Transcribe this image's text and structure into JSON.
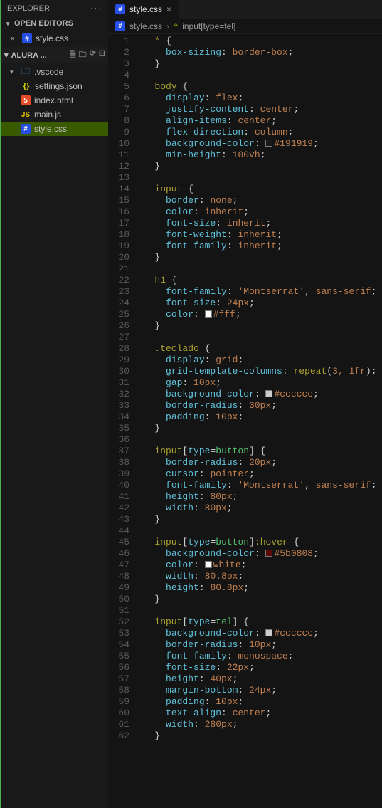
{
  "sidebar": {
    "header": "EXPLORER",
    "openEditorsTitle": "OPEN EDITORS",
    "openEditors": [
      {
        "name": "style.css"
      }
    ],
    "folderName": "ALURA ...",
    "tree": {
      "vscode": ".vscode",
      "settings": "settings.json",
      "index": "index.html",
      "main": "main.js",
      "style": "style.css"
    }
  },
  "tab": {
    "name": "style.css"
  },
  "breadcrumb": {
    "file": "style.css",
    "symbol": "input[type=tel]"
  },
  "code": {
    "lines": [
      {
        "n": 1,
        "t": "sel-open",
        "a": "*",
        "b": " {"
      },
      {
        "n": 2,
        "t": "prop",
        "p": "box-sizing",
        "v": "border-box"
      },
      {
        "n": 3,
        "t": "close"
      },
      {
        "n": 4,
        "t": "blank"
      },
      {
        "n": 5,
        "t": "sel-open",
        "a": "body",
        "b": " {"
      },
      {
        "n": 6,
        "t": "prop",
        "p": "display",
        "v": "flex"
      },
      {
        "n": 7,
        "t": "prop",
        "p": "justify-content",
        "v": "center"
      },
      {
        "n": 8,
        "t": "prop",
        "p": "align-items",
        "v": "center"
      },
      {
        "n": 9,
        "t": "prop",
        "p": "flex-direction",
        "v": "column"
      },
      {
        "n": 10,
        "t": "prop-color",
        "p": "background-color",
        "v": "#191919",
        "c": "#191919"
      },
      {
        "n": 11,
        "t": "prop",
        "p": "min-height",
        "v": "100vh"
      },
      {
        "n": 12,
        "t": "close"
      },
      {
        "n": 13,
        "t": "blank"
      },
      {
        "n": 14,
        "t": "sel-open",
        "a": "input",
        "b": " {"
      },
      {
        "n": 15,
        "t": "prop",
        "p": "border",
        "v": "none"
      },
      {
        "n": 16,
        "t": "prop",
        "p": "color",
        "v": "inherit"
      },
      {
        "n": 17,
        "t": "prop",
        "p": "font-size",
        "v": "inherit"
      },
      {
        "n": 18,
        "t": "prop",
        "p": "font-weight",
        "v": "inherit"
      },
      {
        "n": 19,
        "t": "prop",
        "p": "font-family",
        "v": "inherit"
      },
      {
        "n": 20,
        "t": "close"
      },
      {
        "n": 21,
        "t": "blank"
      },
      {
        "n": 22,
        "t": "sel-open",
        "a": "h1",
        "b": " {"
      },
      {
        "n": 23,
        "t": "prop-font",
        "p": "font-family",
        "v1": "'Montserrat'",
        "v2": "sans-serif"
      },
      {
        "n": 24,
        "t": "prop",
        "p": "font-size",
        "v": "24px"
      },
      {
        "n": 25,
        "t": "prop-color",
        "p": "color",
        "v": "#fff",
        "c": "#ffffff"
      },
      {
        "n": 26,
        "t": "close"
      },
      {
        "n": 27,
        "t": "blank"
      },
      {
        "n": 28,
        "t": "sel-open",
        "a": ".teclado",
        "b": " {",
        "cls": "sel"
      },
      {
        "n": 29,
        "t": "prop",
        "p": "display",
        "v": "grid"
      },
      {
        "n": 30,
        "t": "prop-fn",
        "p": "grid-template-columns",
        "fn": "repeat",
        "args": "3, 1fr"
      },
      {
        "n": 31,
        "t": "prop",
        "p": "gap",
        "v": "10px"
      },
      {
        "n": 32,
        "t": "prop-color",
        "p": "background-color",
        "v": "#cccccc",
        "c": "#cccccc"
      },
      {
        "n": 33,
        "t": "prop",
        "p": "border-radius",
        "v": "30px"
      },
      {
        "n": 34,
        "t": "prop",
        "p": "padding",
        "v": "10px"
      },
      {
        "n": 35,
        "t": "close"
      },
      {
        "n": 36,
        "t": "blank"
      },
      {
        "n": 37,
        "t": "sel-attr",
        "a": "input",
        "k": "type",
        "vv": "button",
        "after": ""
      },
      {
        "n": 38,
        "t": "prop",
        "p": "border-radius",
        "v": "20px"
      },
      {
        "n": 39,
        "t": "prop",
        "p": "cursor",
        "v": "pointer"
      },
      {
        "n": 40,
        "t": "prop-font",
        "p": "font-family",
        "v1": "'Montserrat'",
        "v2": "sans-serif"
      },
      {
        "n": 41,
        "t": "prop",
        "p": "height",
        "v": "80px"
      },
      {
        "n": 42,
        "t": "prop",
        "p": "width",
        "v": "80px"
      },
      {
        "n": 43,
        "t": "close"
      },
      {
        "n": 44,
        "t": "blank"
      },
      {
        "n": 45,
        "t": "sel-attr",
        "a": "input",
        "k": "type",
        "vv": "button",
        "after": ":hover"
      },
      {
        "n": 46,
        "t": "prop-color",
        "p": "background-color",
        "v": "#5b0808",
        "c": "#5b0808"
      },
      {
        "n": 47,
        "t": "prop-color",
        "p": "color",
        "v": "white",
        "c": "#ffffff"
      },
      {
        "n": 48,
        "t": "prop",
        "p": "width",
        "v": "80.8px"
      },
      {
        "n": 49,
        "t": "prop",
        "p": "height",
        "v": "80.8px"
      },
      {
        "n": 50,
        "t": "close"
      },
      {
        "n": 51,
        "t": "blank"
      },
      {
        "n": 52,
        "t": "sel-attr",
        "a": "input",
        "k": "type",
        "vv": "tel",
        "after": ""
      },
      {
        "n": 53,
        "t": "prop-color",
        "p": "background-color",
        "v": "#cccccc",
        "c": "#cccccc"
      },
      {
        "n": 54,
        "t": "prop",
        "p": "border-radius",
        "v": "10px"
      },
      {
        "n": 55,
        "t": "prop",
        "p": "font-family",
        "v": "monospace"
      },
      {
        "n": 56,
        "t": "prop",
        "p": "font-size",
        "v": "22px"
      },
      {
        "n": 57,
        "t": "prop",
        "p": "height",
        "v": "40px"
      },
      {
        "n": 58,
        "t": "prop",
        "p": "margin-bottom",
        "v": "24px"
      },
      {
        "n": 59,
        "t": "prop",
        "p": "padding",
        "v": "10px"
      },
      {
        "n": 60,
        "t": "prop",
        "p": "text-align",
        "v": "center"
      },
      {
        "n": 61,
        "t": "prop",
        "p": "width",
        "v": "280px"
      },
      {
        "n": 62,
        "t": "close"
      }
    ]
  }
}
